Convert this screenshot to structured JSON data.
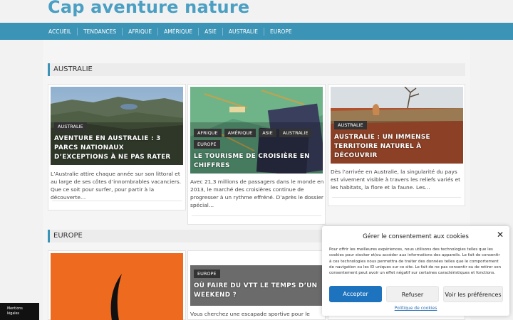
{
  "site": {
    "title": "Cap aventure nature"
  },
  "nav": [
    "ACCUEIL",
    "TENDANCES",
    "AFRIQUE",
    "AMÉRIQUE",
    "ASIE",
    "AUSTRALIE",
    "EUROPE"
  ],
  "sections": {
    "australie": "AUSTRALIE",
    "europe": "EUROPE"
  },
  "cards": [
    {
      "cats": [
        "AUSTRALIE"
      ],
      "title": "AVENTURE EN AUSTRALIE : 3 PARCS NATIONAUX D’EXCEPTIONS À NE PAS RATER",
      "excerpt": "L’Australie attire chaque année sur son littoral et au large de ses côtes d’innombrables vacanciers. Que ce soit pour surfer, pour partir à la découverte…"
    },
    {
      "cats": [
        "AFRIQUE",
        "AMÉRIQUE",
        "ASIE",
        "AUSTRALIE",
        "EUROPE"
      ],
      "title": "LE TOURISME DE CROISIÈRE EN CHIFFRES",
      "excerpt": "Avec 21,3 millions de passagers dans le monde en 2013, le marché des croisières continue de progresser à un rythme effréné. D’après le dossier spécial…"
    },
    {
      "cats": [
        "AUSTRALIE"
      ],
      "title": "AUSTRALIE : UN IMMENSE TERRITOIRE NATUREL À DÉCOUVRIR",
      "excerpt": "Dès l’arrivée en Australie, la singularité du pays est vivement visible  à travers les reliefs variés et les habitats, la flore et la faune. Les…"
    },
    {
      "cats": [
        "EUROPE"
      ],
      "title": "OÙ FAIRE DU VTT LE TEMPS D’UN WEEKEND ?",
      "excerpt": "Vous cherchez une escapade sportive pour le"
    }
  ],
  "cookie": {
    "title": "Gérer le consentement aux cookies",
    "text": "Pour offrir les meilleures expériences, nous utilisons des technologies telles que les cookies pour stocker et/ou accéder aux informations des appareils. Le fait de consentir à ces technologies nous permettra de traiter des données telles que le comportement de navigation ou les ID uniques sur ce site. Le fait de ne pas consentir ou de retirer son consentement peut avoir un effet négatif sur certaines caractéristiques et fonctions.",
    "accept": "Accepter",
    "refuse": "Refuser",
    "prefs": "Voir les préférences",
    "policy": "Politique de cookies"
  },
  "legal": {
    "line1": "Mentions",
    "line2": "légales"
  },
  "colors": {
    "brand": "#4a9fc3",
    "nav": "#3b93b5",
    "accept": "#1e73be",
    "dark": "#111111"
  }
}
